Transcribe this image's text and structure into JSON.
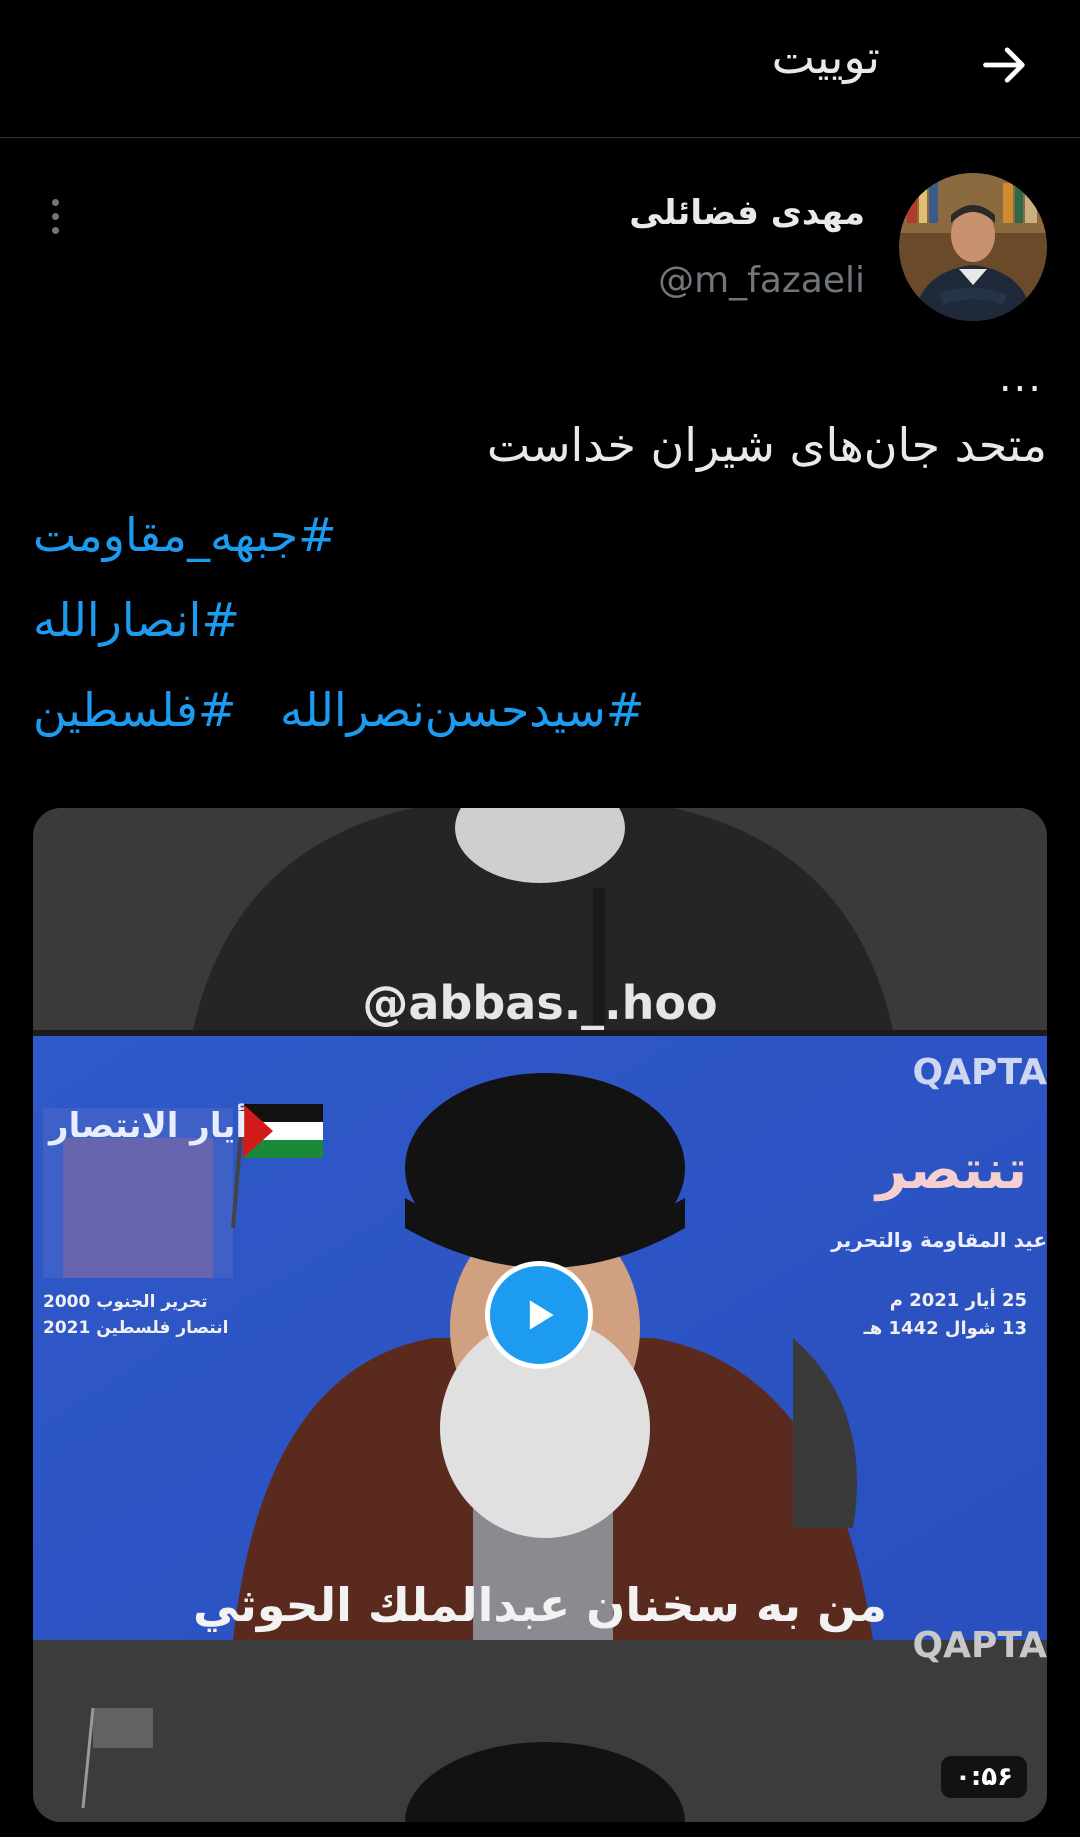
{
  "header": {
    "title": "توییت"
  },
  "author": {
    "name": "مهدی فضائلی",
    "handle": "@m_fazaeli"
  },
  "tweet": {
    "ellipsis": "...",
    "text": "متحد جان‌های شیران خداست",
    "hashtags": [
      "#جبهه_مقاومت",
      "#انصارالله",
      "#سیدحسن‌نصرالله",
      "#فلسطین"
    ]
  },
  "media": {
    "type": "video",
    "duration": "۰:۵۶",
    "watermark": "@abbas._.hoo",
    "caption": "من به سخنان عبدالملك الحوثي",
    "frame_texts": {
      "brand": "QAPTA",
      "left_event": "أيار الانتصار",
      "left_line1": "تحرير الجنوب 2000",
      "left_line2": "انتصار فلسطين 2021",
      "right_title": "تنتصر",
      "right_sub": "عيد المقاومة والتحرير",
      "date1": "25 أيار 2021 م",
      "date2": "13 شوال 1442 هـ"
    }
  },
  "colors": {
    "accent": "#1d9bf0",
    "background": "#000000",
    "secondary_text": "#71767b"
  }
}
